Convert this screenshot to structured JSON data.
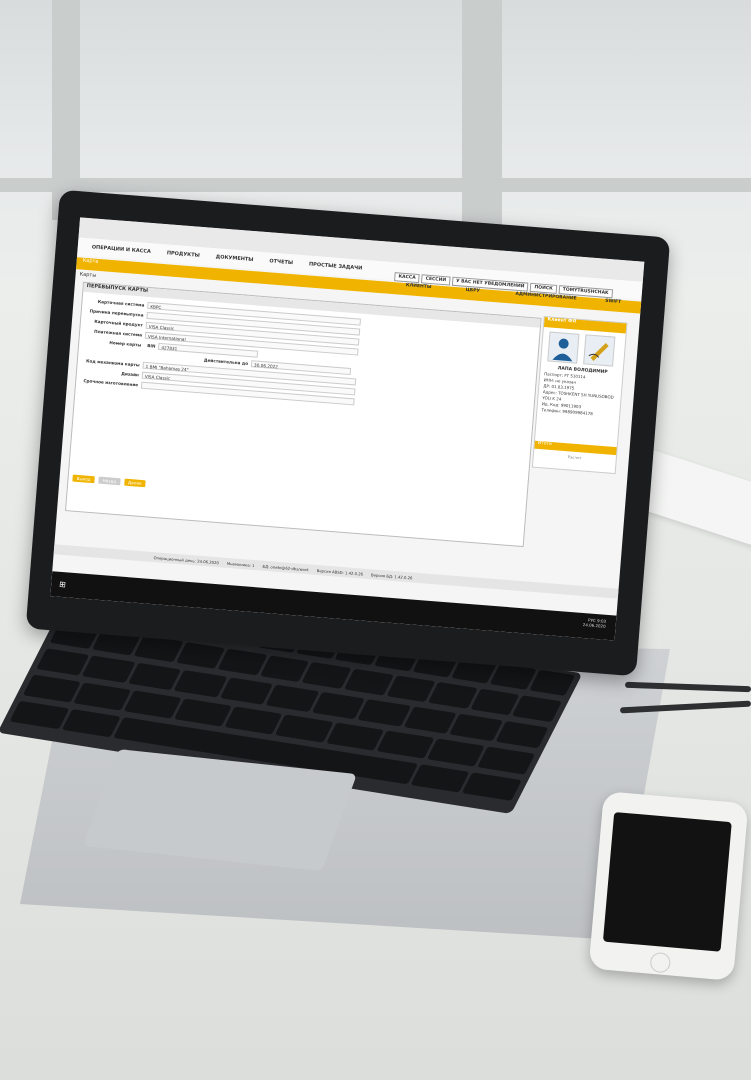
{
  "app": {
    "top_menu": [
      "ОПЕРАЦИИ И КАССА",
      "ПРОДУКТЫ",
      "ДОКУМЕНТЫ",
      "ОТЧЕТЫ",
      "ПРОСТЫЕ ЗАДАЧИ"
    ],
    "right_menu": [
      "КАССА",
      "СЕССИИ",
      "У ВАС НЕТ УВЕДОМЛЕНИЙ",
      "ПОИСК",
      "TOMYTRUSHCHAK"
    ],
    "second_menu": [
      "КЛИЕНТЫ",
      "ЦБРУ",
      "АДМИНИСТРИРОВАНИЕ",
      "SWIFT"
    ],
    "section_tab": "Карта",
    "breadcrumb": "Карты",
    "panel_title": "ПЕРЕВЫПУСК КАРТЫ",
    "fields": [
      {
        "label": "Карточная система",
        "value": "KBPC"
      },
      {
        "label": "Причина перевыпуска",
        "value": ""
      },
      {
        "label": "Карточный продукт",
        "value": "VISA Classic"
      },
      {
        "label": "Платежная система",
        "value": "VISA International"
      },
      {
        "label": "Номер карты",
        "value": "427831"
      },
      {
        "label": "Действительна до",
        "value": "30.06.2022"
      },
      {
        "label": "Код механизма карты",
        "value": "1  BMI \"Bahamas 24\""
      },
      {
        "label": "Дизайн",
        "value": "VISA Classic"
      },
      {
        "label": "Срочное изготовление",
        "value": ""
      }
    ],
    "bin_label": "BIN",
    "buttons": {
      "ok": "Выход",
      "back": "Назад",
      "next": "Далее"
    },
    "client_panel": {
      "title": "Клиент ФЛ",
      "name": "ЛАПА ВОЛОДИМИР",
      "lines": [
        "Паспорт: FT 510114",
        "ИНН: не указан",
        "ДР: 01.03.1975",
        "Адрес: TOSHKENT SH YUNUSOBOD YOLI K 24",
        "Ид. Код: 99011903",
        "Телефон: 998909984178"
      ],
      "section": "Итоги",
      "calc": "Расчет"
    },
    "status": [
      "Операционный день: 24.06.2020",
      "Мнемоника: 1",
      "БД: onebr@62-dbs/work",
      "Версия ABSD: 1.42.0.26",
      "Версия БД: 1.42.0.26"
    ],
    "tray": {
      "time": "9:03",
      "date": "24.06.2020",
      "lang": "РУС"
    }
  }
}
